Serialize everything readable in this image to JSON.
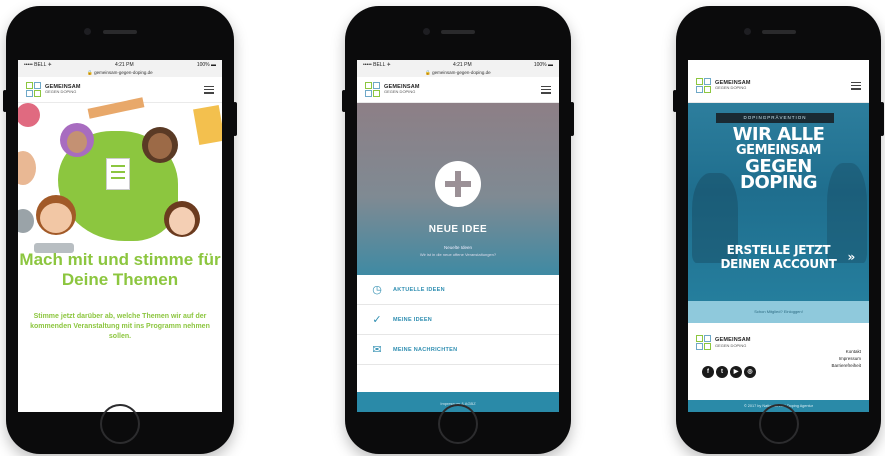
{
  "phones": [
    {
      "status": {
        "carrier": "••••• BELL ✈",
        "time": "4:21 PM",
        "battery": "100% ▬"
      },
      "url": "🔒 gemeinsam-gegen-doping.de",
      "logo": {
        "line1": "GEMEINSAM",
        "line2": "GEGEN DOPING"
      },
      "headline": "Mach mit und stimme für Deine Themen",
      "body": "Stimme jetzt darüber ab, welche Themen wir auf der kommenden Veranstaltung mit ins Programm nehmen sollen."
    },
    {
      "status": {
        "carrier": "••••• BELL ✈",
        "time": "4:21 PM",
        "battery": "100% ▬"
      },
      "url": "🔒 gemeinsam-gegen-doping.de",
      "logo": {
        "line1": "GEMEINSAM",
        "line2": "GEGEN DOPING"
      },
      "hero_title": "NEUE IDEE",
      "hero_sub1": "Neuelte Ideen",
      "hero_sub2": "Wir ist in die neue offene Veranstaltungen?",
      "menu": [
        {
          "icon": "clock-icon",
          "glyph": "◷",
          "label": "AKTUELLE IDEEN"
        },
        {
          "icon": "check-icon",
          "glyph": "✓",
          "label": "MEINE IDEEN"
        },
        {
          "icon": "mail-icon",
          "glyph": "✉",
          "label": "MEINE NACHRICHTEN"
        }
      ],
      "footer": "Impressum & AGBZ"
    },
    {
      "status": {
        "carrier": "",
        "time": "",
        "battery": ""
      },
      "logo": {
        "line1": "GEMEINSAM",
        "line2": "GEGEN DOPING"
      },
      "ribbon": "DOPINGPRÄVENTION",
      "big_lines": [
        "WIR ALLE",
        "GEMEINSAM",
        "GEGEN",
        "DOPING"
      ],
      "cta_lines": [
        "ERSTELLE JETZT",
        "DEINEN ACCOUNT"
      ],
      "cta_arrow": "»",
      "note": "Schon Mitglied? Einloggen!",
      "footer_logo": {
        "line1": "GEMEINSAM",
        "line2": "GEGEN DOPING"
      },
      "links": [
        "Kontakt",
        "Impressum",
        "Barrierefreiheit"
      ],
      "social": [
        "f",
        "t",
        "▶",
        "◎"
      ],
      "footer": "© 2017 by Nationale Anti Doping Agentur"
    }
  ]
}
